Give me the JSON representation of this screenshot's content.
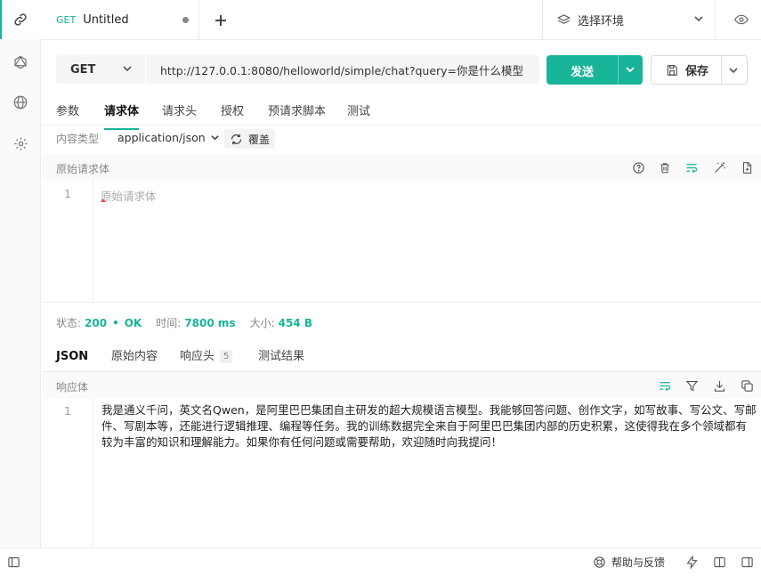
{
  "tabbar": {
    "tab_method": "GET",
    "tab_title": "Untitled",
    "environment_label": "选择环境"
  },
  "request": {
    "method": "GET",
    "url": "http://127.0.0.1:8080/helloworld/simple/chat?query=你是什么模型",
    "send_label": "发送",
    "save_label": "保存"
  },
  "request_tabs": [
    "参数",
    "请求体",
    "请求头",
    "授权",
    "预请求脚本",
    "测试"
  ],
  "body": {
    "content_type_label": "内容类型",
    "content_type_value": "application/json",
    "override_label": "覆盖",
    "section_title": "原始请求体",
    "line_number": "1",
    "placeholder": "原始请求体"
  },
  "status": {
    "status_label": "状态:",
    "status_code": "200",
    "status_text": "OK",
    "time_label": "时间:",
    "time_value": "7800 ms",
    "size_label": "大小:",
    "size_value": "454 B"
  },
  "response_tabs": [
    {
      "label": "JSON"
    },
    {
      "label": "原始内容"
    },
    {
      "label": "响应头",
      "badge": "5"
    },
    {
      "label": "测试结果"
    }
  ],
  "response": {
    "section_title": "响应体",
    "line_number": "1",
    "text": "我是通义千问，英文名Qwen，是阿里巴巴集团自主研发的超大规模语言模型。我能够回答问题、创作文字，如写故事、写公文、写邮件、写剧本等，还能进行逻辑推理、编程等任务。我的训练数据完全来自于阿里巴巴集团内部的历史积累，这使得我在多个领域都有较为丰富的知识和理解能力。如果你有任何问题或需要帮助，欢迎随时向我提问！"
  },
  "footer": {
    "help_label": "帮助与反馈"
  },
  "colors": {
    "accent": "#18b49a",
    "text": "#333333",
    "muted": "#888888",
    "border": "#ececec"
  }
}
